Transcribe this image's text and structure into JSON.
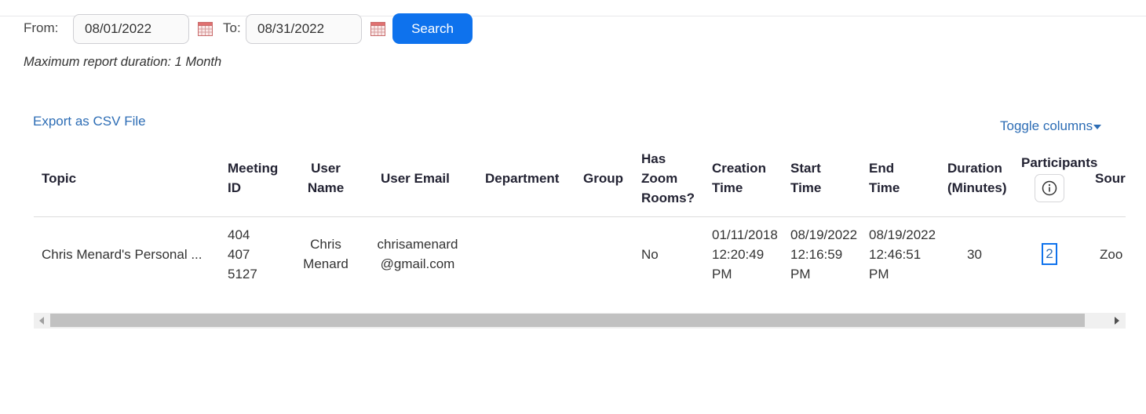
{
  "filters": {
    "from_label": "From:",
    "from_value": "08/01/2022",
    "to_label": "To:",
    "to_value": "08/31/2022",
    "search_label": "Search",
    "note": "Maximum report duration: 1 Month"
  },
  "actions": {
    "export_label": "Export as CSV File",
    "toggle_label": "Toggle columns"
  },
  "table": {
    "headers": {
      "topic": "Topic",
      "meeting_id": [
        "Meeting",
        "ID"
      ],
      "user_name": [
        "User",
        "Name"
      ],
      "user_email": "User Email",
      "department": "Department",
      "group": "Group",
      "zoom_rooms": [
        "Has",
        "Zoom",
        "Rooms?"
      ],
      "creation_time": [
        "Creation",
        "Time"
      ],
      "start_time": [
        "Start",
        "Time"
      ],
      "end_time": [
        "End",
        "Time"
      ],
      "duration": [
        "Duration",
        "(Minutes)"
      ],
      "participants": "Participants",
      "source": "Sour"
    },
    "rows": [
      {
        "topic": "Chris Menard's Personal ...",
        "meeting_id": [
          "404",
          "407",
          "5127"
        ],
        "user_name": [
          "Chris",
          "Menard"
        ],
        "user_email": [
          "chrisamenard",
          "@gmail.com"
        ],
        "department": "",
        "group": "",
        "zoom_rooms": "No",
        "creation_time": [
          "01/11/2018",
          "12:20:49",
          "PM"
        ],
        "start_time": [
          "08/19/2022",
          "12:16:59",
          "PM"
        ],
        "end_time": [
          "08/19/2022",
          "12:46:51",
          "PM"
        ],
        "duration": "30",
        "participants": "2",
        "source": "Zoo"
      }
    ]
  },
  "icons": {
    "calendar": "calendar-icon",
    "info": "info-icon",
    "caret": "caret-down-icon"
  },
  "colors": {
    "accent": "#0e72ed",
    "link": "#2d6db5"
  }
}
